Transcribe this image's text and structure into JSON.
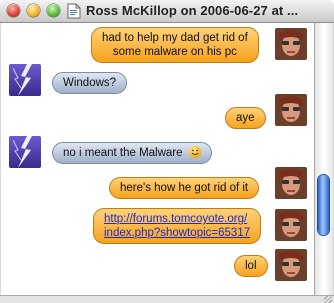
{
  "window": {
    "title": "Ross McKillop on 2006-06-27 at ..."
  },
  "icons": {
    "close": "close-button",
    "minimize": "minimize-button",
    "zoom": "zoom-button",
    "doc": "document-icon",
    "smiley": "smiley-icon"
  },
  "messages": [
    {
      "sender": "self",
      "lines": [
        "had to help my dad get rid of",
        "some malware on his pc"
      ]
    },
    {
      "sender": "buddy",
      "lines": [
        "Windows?"
      ]
    },
    {
      "sender": "self",
      "lines": [
        "aye"
      ]
    },
    {
      "sender": "buddy",
      "lines": [
        "no i meant the Malware"
      ],
      "emoticon": "smiley"
    },
    {
      "sender": "self",
      "lines": [
        "here's how he got rid of it"
      ]
    },
    {
      "sender": "self",
      "link": true,
      "lines": [
        "http://forums.tomcoyote.org/",
        "index.php?showtopic=65317"
      ]
    },
    {
      "sender": "self",
      "lines": [
        "lol"
      ]
    }
  ],
  "colors": {
    "self_bubble": "#f6a21c",
    "buddy_bubble": "#9fb0c8",
    "link": "#1a2bd0",
    "scroll_thumb": "#2c64c8"
  }
}
